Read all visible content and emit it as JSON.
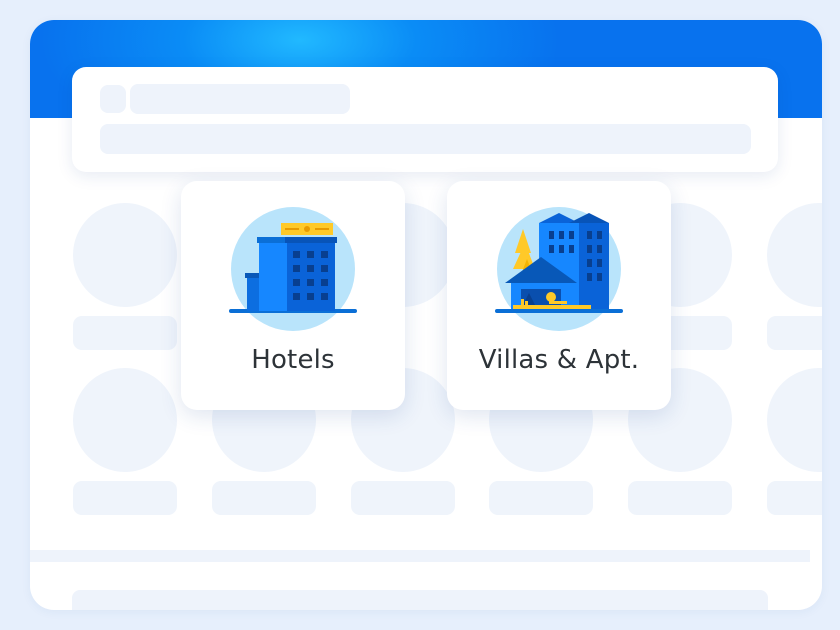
{
  "colors": {
    "page_bg": "#e6effc",
    "brand_blue": "#0872ee",
    "highlight_blue": "#21b9ff",
    "placeholder": "#eef3fb",
    "label_text": "#2d3338",
    "accent_yellow": "#ffc928"
  },
  "categories": [
    {
      "label": "Hotels",
      "icon": "hotel-building-icon"
    },
    {
      "label": "Villas & Apt.",
      "icon": "villa-apartment-icon"
    }
  ]
}
